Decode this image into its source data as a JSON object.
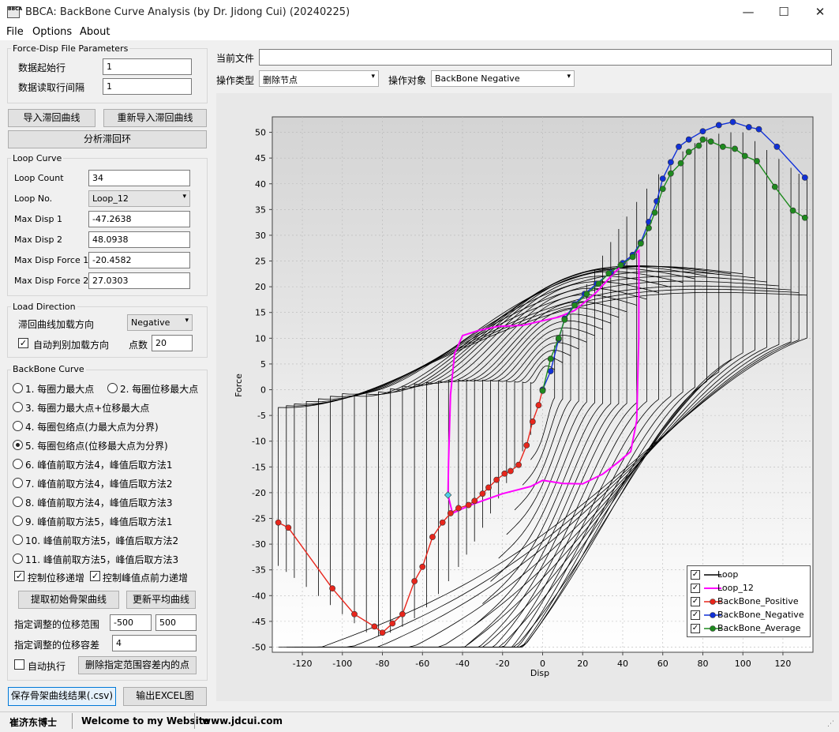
{
  "window": {
    "title": "BBCA: BackBone Curve Analysis (by Dr. Jidong Cui) (20240225)",
    "icon_text": "BBCA",
    "minimize": "—",
    "maximize": "☐",
    "close": "✕"
  },
  "menu": [
    "File",
    "Options",
    "About"
  ],
  "file_params": {
    "title": "Force-Disp File Parameters",
    "start_row_label": "数据起始行",
    "start_row": "1",
    "interval_label": "数据读取行间隔",
    "interval": "1"
  },
  "buttons": {
    "import": "导入滞回曲线",
    "reimport": "重新导入滞回曲线",
    "analyze": "分析滞回环",
    "extract": "提取初始骨架曲线",
    "update_avg": "更新平均曲线",
    "delete_points": "删除指定范围容差内的点",
    "save_csv": "保存骨架曲线结果(.csv)",
    "export_excel": "输出EXCEL图"
  },
  "loop_curve": {
    "title": "Loop Curve",
    "fields": [
      {
        "label": "Loop Count",
        "value": "34"
      },
      {
        "label": "Loop No.",
        "value": "Loop_12"
      },
      {
        "label": "Max Disp 1",
        "value": "-47.2638"
      },
      {
        "label": "Max Disp 2",
        "value": "48.0938"
      },
      {
        "label": "Max Disp Force 1",
        "value": "-20.4582"
      },
      {
        "label": "Max Disp Force 2",
        "value": "27.0303"
      }
    ]
  },
  "load_direction": {
    "title": "Load Direction",
    "dir_label": "滞回曲线加载方向",
    "dir_value": "Negative",
    "auto_label": "自动判别加载方向",
    "auto_checked": true,
    "points_label": "点数",
    "points_value": "20"
  },
  "backbone": {
    "title": "BackBone Curve",
    "options": [
      "1. 每圈力最大点",
      "2. 每圈位移最大点",
      "3. 每圈力最大点+位移最大点",
      "4. 每圈包络点(力最大点为分界)",
      "5. 每圈包络点(位移最大点为分界)",
      "6. 峰值前取方法4，峰值后取方法1",
      "7. 峰值前取方法4，峰值后取方法2",
      "8. 峰值前取方法4，峰值后取方法3",
      "9. 峰值前取方法5，峰值后取方法1",
      "10. 峰值前取方法5，峰值后取方法2",
      "11. 峰值前取方法5，峰值后取方法3"
    ],
    "selected": 4,
    "check_disp": "控制位移递增",
    "check_force": "控制峰值点前力递增",
    "range_label": "指定调整的位移范围",
    "range_min": "-500",
    "range_max": "500",
    "tol_label": "指定调整的位移容差",
    "tol_value": "4",
    "auto_exec": "自动执行"
  },
  "top_controls": {
    "file_label": "当前文件",
    "file_value": "",
    "op_type_label": "操作类型",
    "op_type_value": "删除节点",
    "op_target_label": "操作对象",
    "op_target_value": "BackBone Negative"
  },
  "status": {
    "author": "崔济东博士",
    "welcome": "Welcome to my Website",
    "site": "www.jdcui.com"
  },
  "colors": {
    "loop": "#000000",
    "loop12": "#ff00ff",
    "positive": "#e8261c",
    "negative": "#1030d8",
    "average": "#1e8a1e"
  },
  "chart_data": {
    "type": "line",
    "xlabel": "Disp",
    "ylabel": "Force",
    "xlim": [
      -135,
      135
    ],
    "ylim": [
      -51,
      53
    ],
    "xticks": [
      -120,
      -100,
      -80,
      -60,
      -40,
      -20,
      0,
      20,
      40,
      60,
      80,
      100,
      120
    ],
    "yticks": [
      -50,
      -45,
      -40,
      -35,
      -30,
      -25,
      -20,
      -15,
      -10,
      -5,
      0,
      5,
      10,
      15,
      20,
      25,
      30,
      35,
      40,
      45,
      50
    ],
    "legend": [
      "Loop",
      "Loop_12",
      "BackBone_Positive",
      "BackBone_Negative",
      "BackBone_Average"
    ],
    "legend_position": "bottom-right",
    "backbone_positive": [
      [
        -132,
        -25.8
      ],
      [
        -127,
        -26.8
      ],
      [
        -105,
        -38.6
      ],
      [
        -94,
        -43.6
      ],
      [
        -84,
        -46
      ],
      [
        -80,
        -47.2
      ],
      [
        -75,
        -45.4
      ],
      [
        -70,
        -43.6
      ],
      [
        -64,
        -37.2
      ],
      [
        -60,
        -34.4
      ],
      [
        -55,
        -28.6
      ],
      [
        -50,
        -25.8
      ],
      [
        -46,
        -24
      ],
      [
        -42,
        -23
      ],
      [
        -37,
        -22.4
      ],
      [
        -34,
        -21.6
      ],
      [
        -30,
        -20.2
      ],
      [
        -27,
        -19
      ],
      [
        -23,
        -17.5
      ],
      [
        -19,
        -16.3
      ],
      [
        -16,
        -15.8
      ],
      [
        -12,
        -14.6
      ],
      [
        -8,
        -10.8
      ],
      [
        -5,
        -6.2
      ],
      [
        -2,
        -3
      ],
      [
        0,
        0
      ]
    ],
    "backbone_negative": [
      [
        0,
        0
      ],
      [
        4,
        3.6
      ],
      [
        8,
        9.8
      ],
      [
        11,
        13.8
      ],
      [
        16,
        16.6
      ],
      [
        21,
        18.6
      ],
      [
        27,
        20.6
      ],
      [
        34,
        22.8
      ],
      [
        40,
        24.6
      ],
      [
        45,
        26.2
      ],
      [
        49,
        28.6
      ],
      [
        53,
        32.6
      ],
      [
        57,
        36.6
      ],
      [
        60,
        41
      ],
      [
        64,
        44.2
      ],
      [
        68,
        47.2
      ],
      [
        73,
        48.6
      ],
      [
        80,
        50.2
      ],
      [
        88,
        51.4
      ],
      [
        95,
        52
      ],
      [
        103,
        51
      ],
      [
        108,
        50.6
      ],
      [
        117,
        47.2
      ],
      [
        131,
        41.2
      ]
    ],
    "backbone_average": [
      [
        0,
        -0.2
      ],
      [
        4,
        6
      ],
      [
        8,
        10
      ],
      [
        11,
        13.6
      ],
      [
        16,
        16.4
      ],
      [
        22,
        18.6
      ],
      [
        28,
        20.6
      ],
      [
        33,
        22.6
      ],
      [
        39,
        24.2
      ],
      [
        45,
        25.8
      ],
      [
        49,
        28.4
      ],
      [
        53,
        31.4
      ],
      [
        56,
        34.4
      ],
      [
        60,
        39
      ],
      [
        64,
        42
      ],
      [
        69,
        44
      ],
      [
        73,
        46.2
      ],
      [
        78,
        47.4
      ],
      [
        80,
        48.6
      ],
      [
        84,
        48.2
      ],
      [
        90,
        47.2
      ],
      [
        96,
        46.8
      ],
      [
        101,
        45.4
      ],
      [
        107,
        44.4
      ],
      [
        116,
        39.4
      ],
      [
        125,
        34.8
      ],
      [
        131,
        33.4
      ]
    ],
    "loop_12": [
      [
        0,
        13.4
      ],
      [
        -10,
        12.5
      ],
      [
        -22,
        12.3
      ],
      [
        -32,
        11.5
      ],
      [
        -40,
        10.5
      ],
      [
        -44,
        7
      ],
      [
        -46,
        -1
      ],
      [
        -47,
        -14
      ],
      [
        -47.26,
        -20.46
      ],
      [
        -45,
        -24
      ],
      [
        -36,
        -22.4
      ],
      [
        -20,
        -20.2
      ],
      [
        -6,
        -18.8
      ],
      [
        0,
        -17.6
      ],
      [
        10,
        -18.2
      ],
      [
        20,
        -18.3
      ],
      [
        30,
        -16.4
      ],
      [
        38,
        -14
      ],
      [
        44,
        -12
      ],
      [
        47,
        -6
      ],
      [
        48,
        10
      ],
      [
        48.09,
        27.03
      ],
      [
        44,
        25.8
      ],
      [
        36,
        22.8
      ],
      [
        26,
        18.6
      ],
      [
        16,
        15.4
      ],
      [
        8,
        14.1
      ],
      [
        0,
        13.4
      ]
    ]
  }
}
